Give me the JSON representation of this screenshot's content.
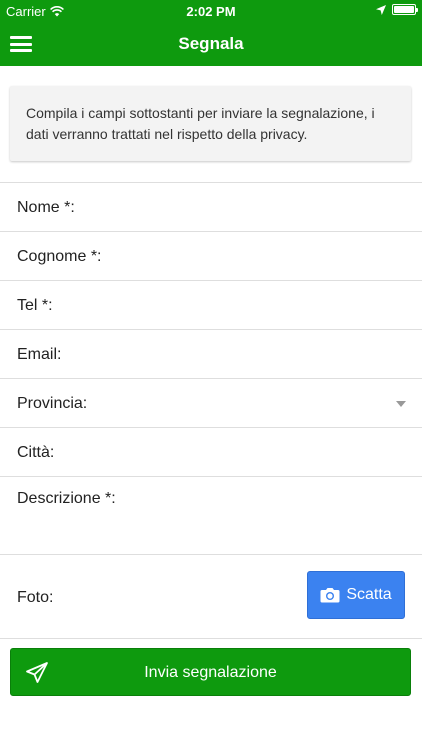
{
  "status_bar": {
    "carrier": "Carrier",
    "time": "2:02 PM"
  },
  "app_bar": {
    "title": "Segnala"
  },
  "info": {
    "text": "Compila i campi sottostanti per inviare la segnalazione, i dati verranno trattati nel rispetto della privacy."
  },
  "form": {
    "nome": {
      "label": "Nome *:",
      "value": ""
    },
    "cognome": {
      "label": "Cognome *:",
      "value": ""
    },
    "tel": {
      "label": "Tel *:",
      "value": ""
    },
    "email": {
      "label": "Email:",
      "value": ""
    },
    "provincia": {
      "label": "Provincia:",
      "value": ""
    },
    "citta": {
      "label": "Città:",
      "value": ""
    },
    "descrizione": {
      "label": "Descrizione *:",
      "value": ""
    },
    "foto": {
      "label": "Foto:",
      "button_label": "Scatta"
    }
  },
  "submit": {
    "label": "Invia segnalazione"
  },
  "colors": {
    "primary_green": "#0e9a0e",
    "button_blue": "#3b82f0"
  },
  "icons": {
    "menu": "hamburger-menu-icon",
    "wifi": "wifi-icon",
    "location": "location-arrow-icon",
    "battery": "battery-icon",
    "dropdown": "chevron-down-icon",
    "camera": "camera-icon",
    "send": "paper-plane-icon"
  }
}
